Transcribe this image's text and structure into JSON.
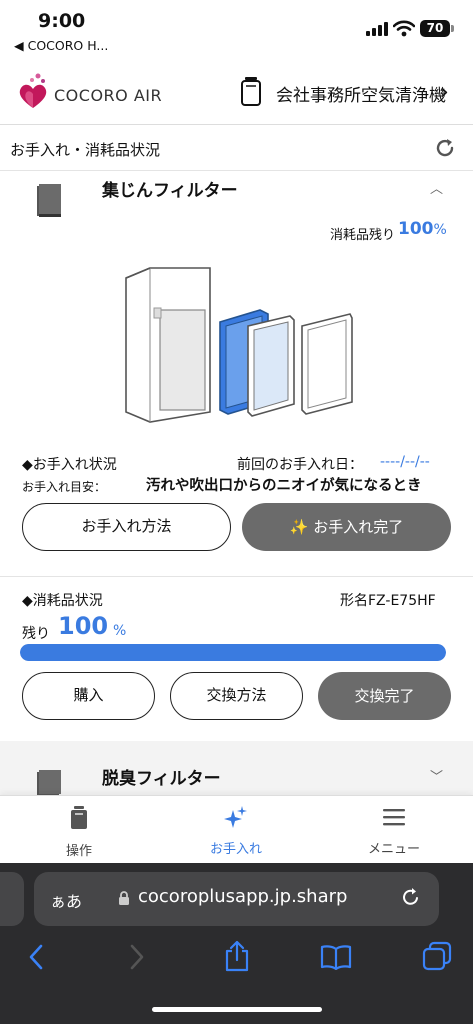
{
  "status_bar": {
    "time": "9:00",
    "back_app": "◀ COCORO H...",
    "battery": "70"
  },
  "header": {
    "brand": "COCORO AIR",
    "device_name": "会社事務所空気清浄機"
  },
  "section": {
    "title": "お手入れ・消耗品状況"
  },
  "filter1": {
    "name": "集じんフィルター",
    "remaining_label": "消耗品残り",
    "remaining_value": "100",
    "remaining_unit": "%",
    "care_status_label": "◆お手入れ状況",
    "last_care_label": "前回のお手入れ日：",
    "last_care_value": "----/--/--",
    "care_guide_label": "お手入れ目安：",
    "care_guide_value": "汚れや吹出口からのニオイが気になるとき",
    "how_to_button": "お手入れ方法",
    "done_button": "✨ お手入れ完了",
    "consumable_label": "◆消耗品状況",
    "model": "形名FZ-E75HF",
    "remain_label": "残り",
    "remain_value": "100",
    "remain_unit": "%",
    "remain_fraction": 1.0,
    "buy_button": "購入",
    "replace_method_button": "交換方法",
    "replace_done_button": "交換完了"
  },
  "filter2": {
    "name": "脱臭フィルター"
  },
  "tabbar": {
    "tabs": [
      {
        "label": "操作"
      },
      {
        "label": "お手入れ"
      },
      {
        "label": "メニュー"
      }
    ],
    "active": 1
  },
  "browser": {
    "aa": "ぁあ",
    "url": "cocoroplusapp.jp.sharp"
  },
  "colors": {
    "accent": "#3a7be0",
    "logo": "#c2185b",
    "chrome": "#2c2c2e"
  }
}
